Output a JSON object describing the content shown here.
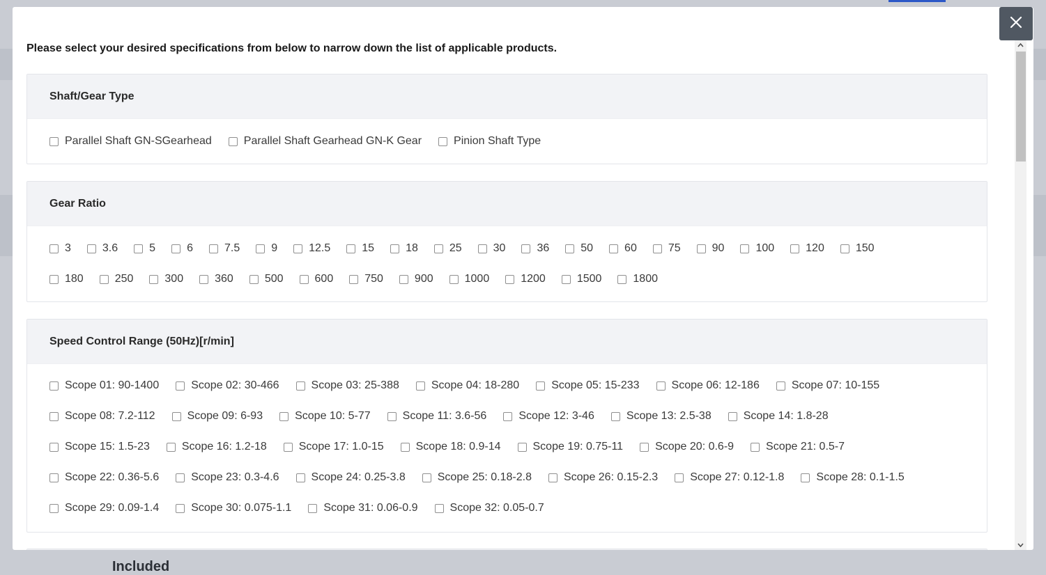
{
  "background": {
    "section_label": "Included"
  },
  "modal": {
    "intro": "Please select your desired specifications from below to narrow down the list of applicable products.",
    "close_icon": "close-icon"
  },
  "sections": {
    "shaft": {
      "title": "Shaft/Gear Type",
      "options": [
        "Parallel Shaft GN-SGearhead",
        "Parallel Shaft Gearhead GN-K Gear",
        "Pinion Shaft Type"
      ]
    },
    "gear_ratio": {
      "title": "Gear Ratio",
      "rows": [
        [
          "3",
          "3.6",
          "5",
          "6",
          "7.5",
          "9",
          "12.5",
          "15",
          "18",
          "25",
          "30",
          "36",
          "50",
          "60",
          "75",
          "90",
          "100",
          "120",
          "150"
        ],
        [
          "180",
          "250",
          "300",
          "360",
          "500",
          "600",
          "750",
          "900",
          "1000",
          "1200",
          "1500",
          "1800"
        ]
      ]
    },
    "speed": {
      "title": "Speed Control Range (50Hz)[r/min]",
      "rows": [
        [
          "Scope 01: 90-1400",
          "Scope 02: 30-466",
          "Scope 03: 25-388",
          "Scope 04: 18-280",
          "Scope 05: 15-233",
          "Scope 06: 12-186",
          "Scope 07: 10-155"
        ],
        [
          "Scope 08: 7.2-112",
          "Scope 09: 6-93",
          "Scope 10: 5-77",
          "Scope 11: 3.6-56",
          "Scope 12: 3-46",
          "Scope 13: 2.5-38",
          "Scope 14: 1.8-28"
        ],
        [
          "Scope 15: 1.5-23",
          "Scope 16: 1.2-18",
          "Scope 17: 1.0-15",
          "Scope 18: 0.9-14",
          "Scope 19: 0.75-11",
          "Scope 20: 0.6-9",
          "Scope 21: 0.5-7"
        ],
        [
          "Scope 22: 0.36-5.6",
          "Scope 23: 0.3-4.6",
          "Scope 24: 0.25-3.8",
          "Scope 25: 0.18-2.8",
          "Scope 26: 0.15-2.3",
          "Scope 27: 0.12-1.8",
          "Scope 28: 0.1-1.5"
        ],
        [
          "Scope 29: 0.09-1.4",
          "Scope 30: 0.075-1.1",
          "Scope 31: 0.06-0.9",
          "Scope 32: 0.05-0.7"
        ]
      ]
    }
  }
}
